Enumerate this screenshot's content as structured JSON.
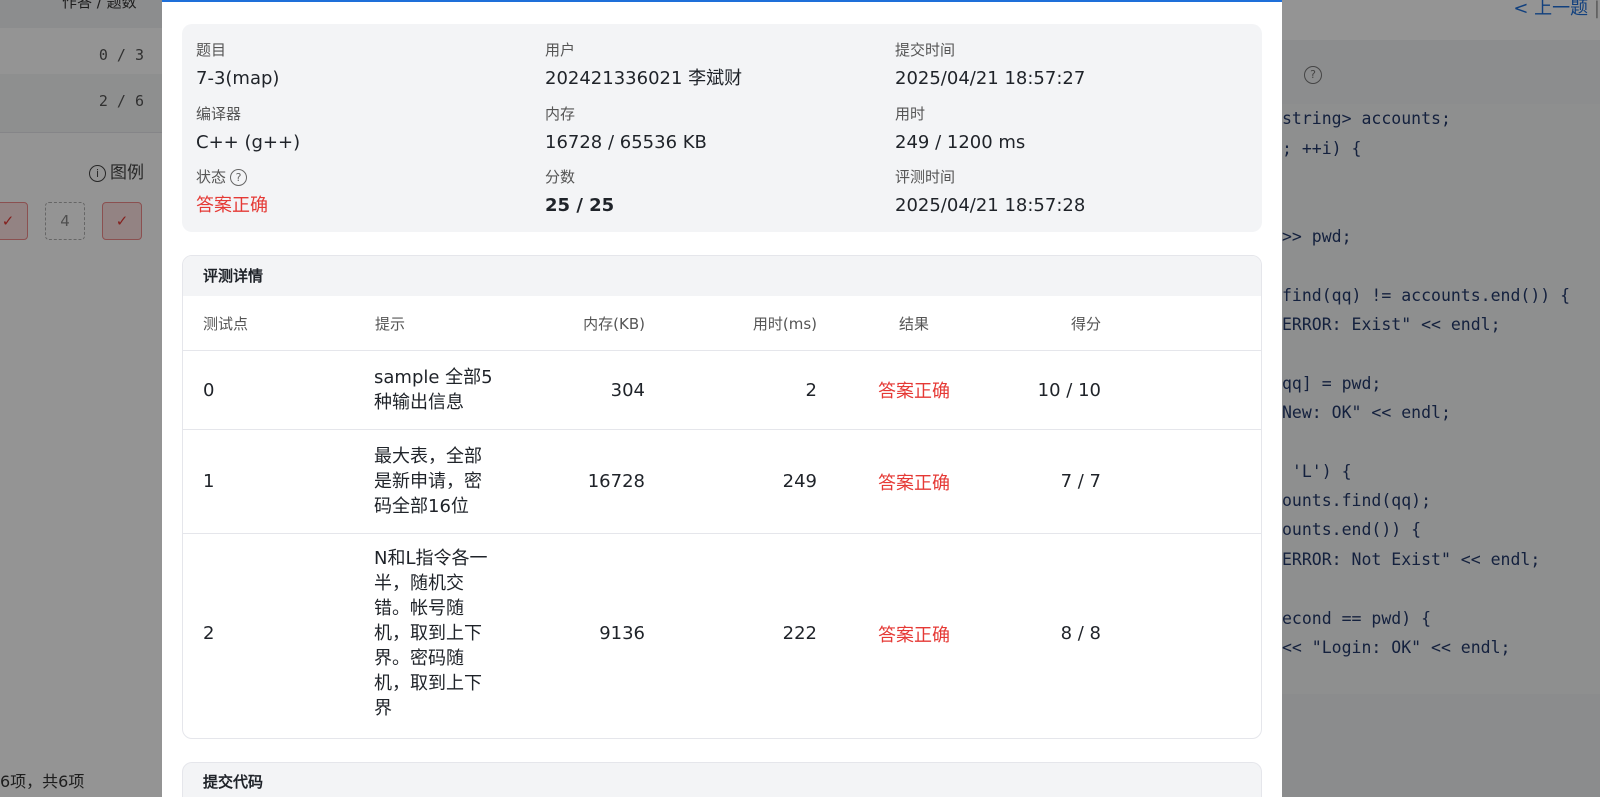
{
  "background": {
    "left_header": "作答 / 题数",
    "rows": [
      "0 / 3",
      "2 / 6"
    ],
    "legend_label": "图例",
    "chip_number": "4",
    "footer": "6项，共6项",
    "nav_prev": "< 上一题",
    "nav_next": "下",
    "code_lines": [
      "string> accounts;",
      "; ++i) {",
      "",
      ">> pwd;",
      "",
      "find(qq) != accounts.end()) {",
      "ERROR: Exist\" << endl;",
      "",
      "qq] = pwd;",
      "New: OK\" << endl;",
      "",
      " 'L') {",
      "ounts.find(qq);",
      "ounts.end()) {",
      "ERROR: Not Exist\" << endl;",
      "",
      "econd == pwd) {",
      "<< \"Login: OK\" << endl;"
    ]
  },
  "summary": {
    "problem_label": "题目",
    "problem": "7-3(map)",
    "user_label": "用户",
    "user": "202421336021 李斌财",
    "submit_time_label": "提交时间",
    "submit_time": "2025/04/21 18:57:27",
    "compiler_label": "编译器",
    "compiler": "C++ (g++)",
    "memory_label": "内存",
    "memory": "16728 / 65536 KB",
    "time_label": "用时",
    "time": "249 / 1200 ms",
    "status_label": "状态",
    "status": "答案正确",
    "score_label": "分数",
    "score": "25 / 25",
    "judge_time_label": "评测时间",
    "judge_time": "2025/04/21 18:57:28"
  },
  "details": {
    "title": "评测详情",
    "columns": [
      "测试点",
      "提示",
      "内存(KB)",
      "用时(ms)",
      "结果",
      "得分"
    ],
    "rows": [
      {
        "id": "0",
        "hint": "sample 全部5种输出信息",
        "memory": "304",
        "time": "2",
        "result": "答案正确",
        "score": "10 / 10"
      },
      {
        "id": "1",
        "hint": "最大表，全部是新申请，密码全部16位",
        "memory": "16728",
        "time": "249",
        "result": "答案正确",
        "score": "7 / 7"
      },
      {
        "id": "2",
        "hint": "N和L指令各一半，随机交错。帐号随机，取到上下界。密码随机，取到上下界",
        "memory": "9136",
        "time": "222",
        "result": "答案正确",
        "score": "8 / 8"
      }
    ]
  },
  "code_section": {
    "title": "提交代码"
  },
  "colors": {
    "accent": "#1e6fd9",
    "success_red": "#e53935"
  }
}
